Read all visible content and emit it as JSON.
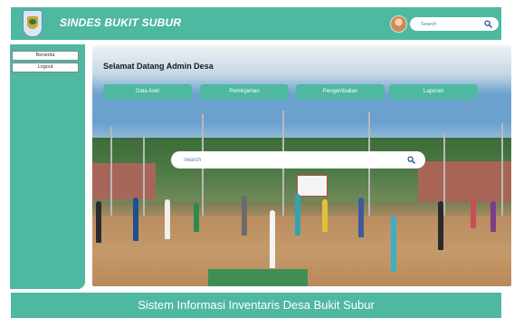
{
  "header": {
    "app_title": "SINDES BUKIT SUBUR",
    "search_placeholder": "Search"
  },
  "sidebar": {
    "items": [
      {
        "label": "Beranda"
      },
      {
        "label": "Logout"
      }
    ]
  },
  "main": {
    "welcome": "Selamat Datang Admin Desa",
    "nav": [
      {
        "label": "Data Aset"
      },
      {
        "label": "Peminjaman"
      },
      {
        "label": "Pengembalian"
      },
      {
        "label": "Laporan"
      }
    ],
    "search_placeholder": "Search"
  },
  "footer": {
    "text": "Sistem Informasi Inventaris Desa Bukit Subur"
  },
  "colors": {
    "accent": "#4fb8a0",
    "button_text": "#ffffff",
    "search_text": "#4a7fb0"
  },
  "icons": [
    "village-emblem-icon",
    "user-avatar",
    "search-icon"
  ]
}
